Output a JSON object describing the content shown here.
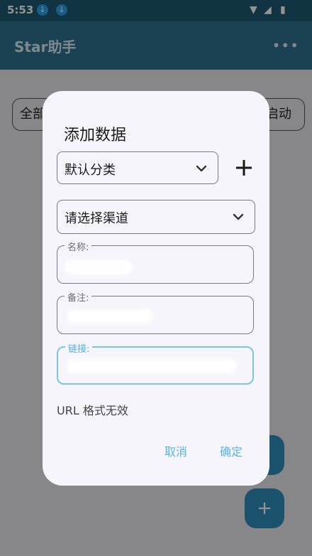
{
  "status_bar": {
    "time": "5:53"
  },
  "app_bar": {
    "title": "Star助手"
  },
  "background": {
    "chip_left": "全部",
    "chip_right": "启动",
    "fab_add": "+"
  },
  "dialog": {
    "title": "添加数据",
    "category_select": {
      "value": "默认分类"
    },
    "channel_select": {
      "value": "请选择渠道"
    },
    "fields": {
      "name": {
        "label": "名称:"
      },
      "note": {
        "label": "备注:"
      },
      "link": {
        "label": "链接:"
      }
    },
    "error_message": "URL 格式无效",
    "buttons": {
      "cancel": "取消",
      "confirm": "确定"
    }
  },
  "colors": {
    "accent": "#58b4e2",
    "focused_border": "#7cc3e6",
    "dialog_bg": "#f6f5fb",
    "appbar": "#2f7390"
  }
}
